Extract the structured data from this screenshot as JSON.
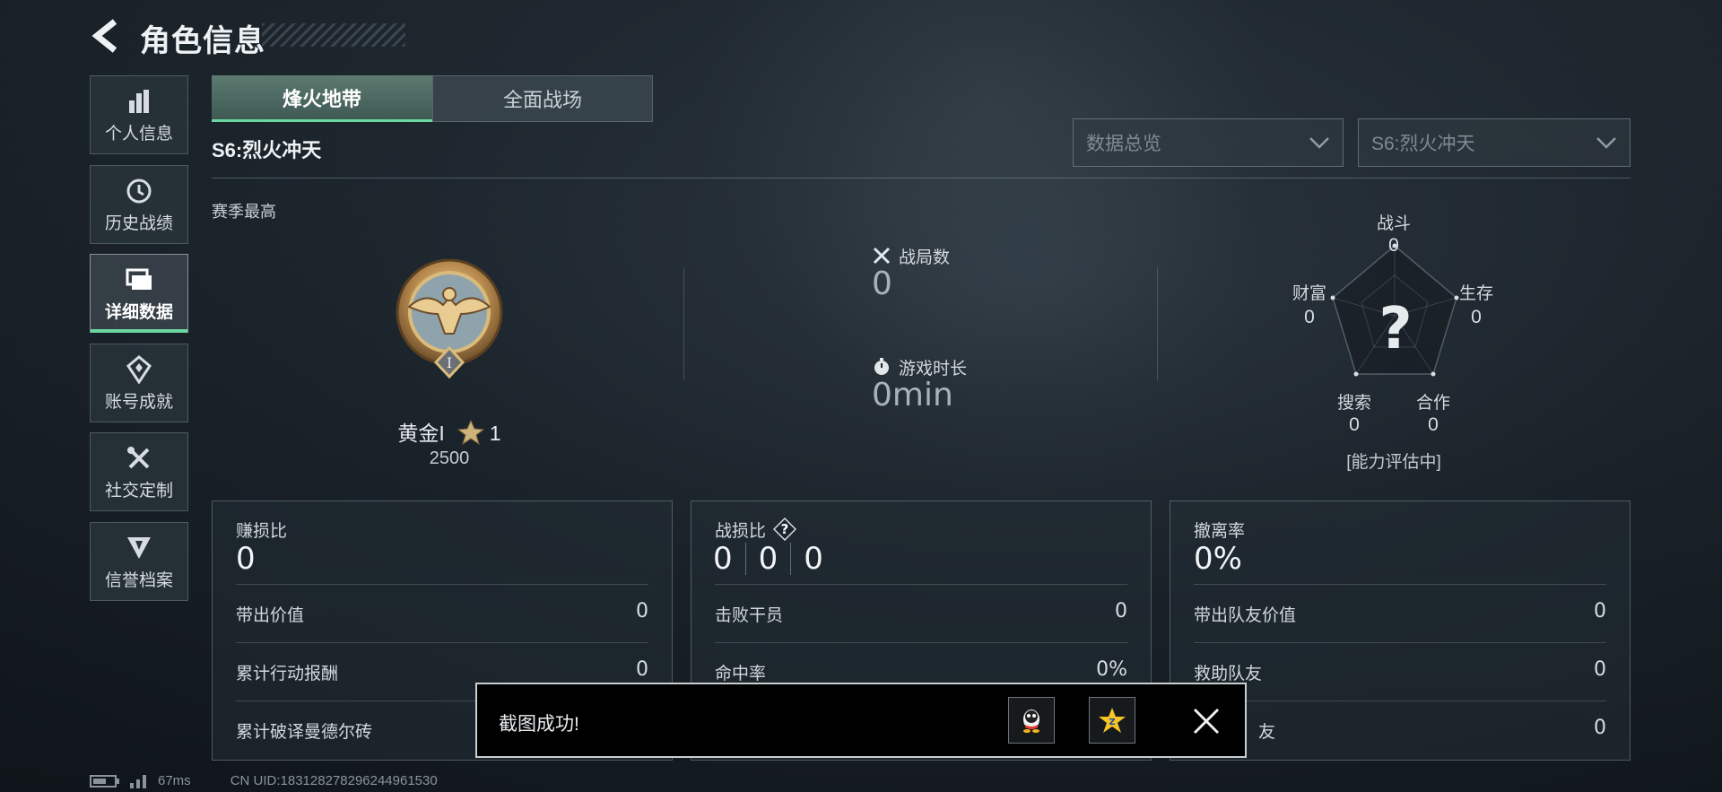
{
  "header": {
    "title": "角色信息"
  },
  "sidebar": {
    "items": [
      {
        "label": "个人信息",
        "icon": "bar-chart-icon"
      },
      {
        "label": "历史战绩",
        "icon": "history-clock-icon"
      },
      {
        "label": "详细数据",
        "icon": "folders-icon",
        "active": true
      },
      {
        "label": "账号成就",
        "icon": "achievement-badge-icon"
      },
      {
        "label": "社交定制",
        "icon": "tools-icon"
      },
      {
        "label": "信誉档案",
        "icon": "credit-shield-icon"
      }
    ]
  },
  "tabs": [
    {
      "label": "烽火地带",
      "active": true
    },
    {
      "label": "全面战场",
      "active": false
    }
  ],
  "season": {
    "title": "S6:烈火冲天",
    "best_label": "赛季最高"
  },
  "filters": {
    "view": "数据总览",
    "season": "S6:烈火冲天"
  },
  "rank": {
    "name": "黄金I",
    "stars": "1",
    "score": "2500"
  },
  "stats": {
    "matches_label": "战局数",
    "matches_value": "0",
    "playtime_label": "游戏时长",
    "playtime_value": "0min"
  },
  "radar": {
    "center": "?",
    "note": "[能力评估中]",
    "axes": {
      "combat": {
        "label": "战斗",
        "value": "0"
      },
      "survival": {
        "label": "生存",
        "value": "0"
      },
      "teamwork": {
        "label": "合作",
        "value": "0"
      },
      "search": {
        "label": "搜索",
        "value": "0"
      },
      "wealth": {
        "label": "财富",
        "value": "0"
      }
    }
  },
  "cards": {
    "profit": {
      "title": "赚损比",
      "value": "0",
      "rows": [
        {
          "label": "带出价值",
          "value": "0"
        },
        {
          "label": "累计行动报酬",
          "value": "0"
        },
        {
          "label": "累计破译曼德尔砖",
          "value": ""
        }
      ]
    },
    "combat": {
      "title": "战损比",
      "values": [
        "0",
        "0",
        "0"
      ],
      "rows": [
        {
          "label": "击败干员",
          "value": "0"
        },
        {
          "label": "命中率",
          "value": "0%"
        },
        {
          "label": "",
          "value": ""
        }
      ]
    },
    "extract": {
      "title": "撤离率",
      "value": "0%",
      "rows": [
        {
          "label": "带出队友价值",
          "value": "0"
        },
        {
          "label": "救助队友",
          "value": "0"
        },
        {
          "label": "友",
          "value": "0"
        }
      ]
    }
  },
  "toast": {
    "text": "截图成功!",
    "share_qq": "qq-share-icon",
    "share_qzone": "qzone-share-icon"
  },
  "footer": {
    "ping": "67ms",
    "uid": "CN UID:1831282782962449615​30"
  },
  "colors": {
    "accent": "#6bd6a1",
    "toast_bg": "#000000"
  }
}
